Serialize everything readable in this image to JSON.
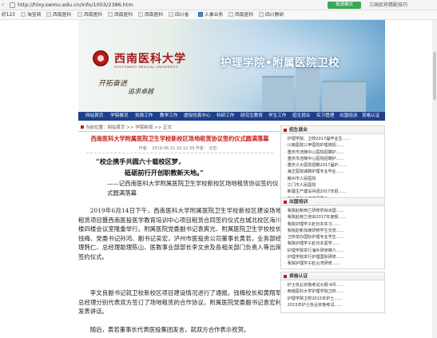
{
  "browser": {
    "url": "http://hlxy.swmu.edu.cn/info/1003/2386.htm",
    "mode_label": "极速模式",
    "right_link": "三国武将猜配技巧"
  },
  "bookmarks": [
    "好123",
    "淘宝网",
    "西南医科",
    "西南医科",
    "西南医科",
    "西南医科",
    "四川省",
    "人事业务",
    "西南医科",
    "四川教研"
  ],
  "banner": {
    "school_name": "西南医科大学",
    "school_en": "SOUTHWEST MEDICAL UNIVERSITY",
    "motto_1": "开拓奋进",
    "motto_2": "追求卓越",
    "college_title": "护理学院•附属医院卫校"
  },
  "mainnav": [
    "网站首页",
    "学院概况",
    "党政工作",
    "教学工作",
    "虚拟仿真中心",
    "科研工作",
    "研究生教育",
    "学生工作",
    "招生就业",
    "实习管理",
    "出国培训",
    "资格认证",
    "专业认证"
  ],
  "crumbs": {
    "label": "当前位置",
    "path": [
      "网站首页",
      "学院新闻",
      "正文"
    ],
    "sep": ">>"
  },
  "article": {
    "title": "西南医科大学附属医院卫生学校新校区场地租赁协议签约仪式圆满落幕",
    "meta": "作者：     2019-06-21 10:12:39    作者：    点击：",
    "quote_1": "“校企携手共圆六十载校区梦，",
    "quote_2": "砥砺前行开创职教新天地。”",
    "source": "——记西南医科大学附属医院卫生学校新校区场地租赁协议签约仪式圆满落幕",
    "paragraphs": [
      "2019年6月14日下午，西南医科大学附属医院卫生学校新校区建设场地租赁项目暨西南医投医学教育培训中心项目租赁合同签约仪式在城北校区海川楼四楼会议室隆重举行。附属医院党委副书记袁爽光、附属医院卫生学校校长钱梅、党委书记孙鸿、副书记吴宏，泸州市医投资公司董事长黄若，业务部经理韩仁、总经理助理陈山、医教事业部部长李文余及各相关部门负责人等出席签约仪式。",
      "李文良副书记就卫校新校区项目建设情况进行了通报。钱梅校长和黄翔军总经理分别代表双方签订了场地租赁的合作协议，附属医院党委副书记袁宏利发表讲话。",
      "随后，黄若董事长代表医投集团发言，就双方合作表示祝贺。"
    ]
  },
  "sidebar": {
    "section_1": {
      "title": "招生就业",
      "items": [
        "护理学院、卫校2017届毕业生……",
        "川南医院三甲医院护理岗招……",
        "重庆市涪陵中心医院招聘护……",
        "重庆市涪陵中心医院招聘护……",
        "重庆义大医院招聘2017届护……",
        "海正医院诚聘护理专业毕业……",
        "赣州市人民医院",
        "江门市人民医院",
        "新疆生产建设兵团2017年招……",
        "毕业生就业双选招聘会……"
      ]
    },
    "section_2": {
      "title": "出国培训",
      "items": [
        "我院赴新西兰研修项目出国……",
        "我院赴荷兰培训2017年度报……",
        "我院护理学子赴日本实习……",
        "我院赴新加坡研修学生交流……",
        "卫校举办国际护理专业学生……",
        "我院护理学子赴日本留学……",
        "护理学院举行海外研修推介……",
        "护理学院举行护理国际研修……",
        "我院护理学子赴台湾研修……"
      ]
    },
    "section_3": {
      "title": "资格认证",
      "items": [
        "护士执业资格考试大纲-9月……",
        "西南医科大学护理学院卫校……",
        "护理学院卫校2015年护士……",
        "2015年护士执业资格考试……"
      ]
    }
  }
}
